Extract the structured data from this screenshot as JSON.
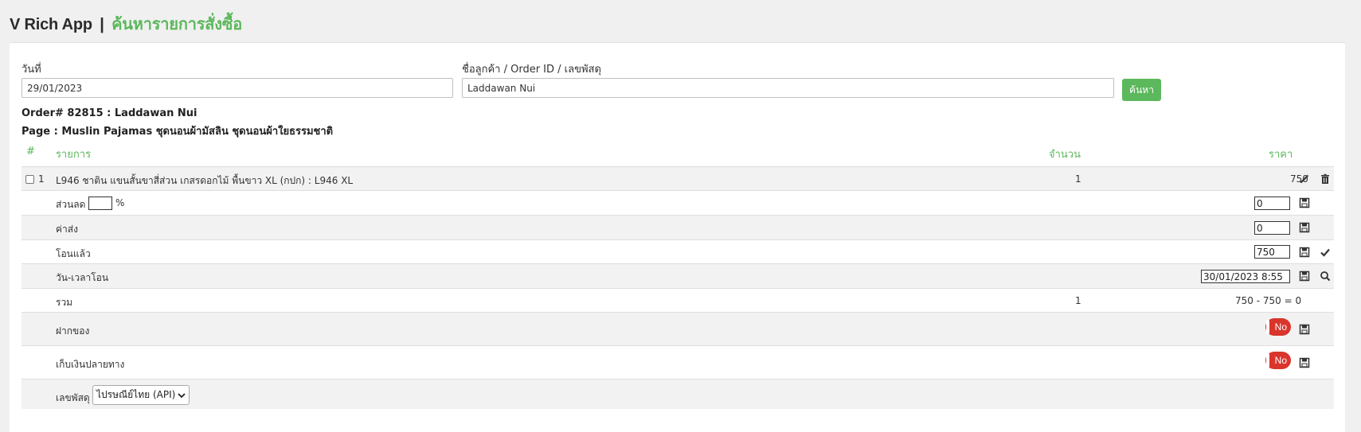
{
  "header": {
    "app": "V Rich App",
    "sep": "|",
    "page": "ค้นหารายการสั่งซื้อ"
  },
  "search": {
    "date_label": "วันที่",
    "date_value": "29/01/2023",
    "query_label": "ชื่อลูกค้า / Order ID / เลขพัสดุ",
    "query_value": "Laddawan Nui",
    "button": "ค้นหา"
  },
  "order": {
    "title": "Order# 82815 : Laddawan Nui",
    "page": "Page : Muslin Pajamas ชุดนอนผ้ามัสลิน ชุดนอนผ้าใยธรรมชาติ"
  },
  "table": {
    "headers": {
      "num": "#",
      "item": "รายการ",
      "qty": "จำนวน",
      "price": "ราคา"
    },
    "item": {
      "index": "1",
      "name": "L946 ชาติน แขนสั้นขาสี่ส่วน เกสรดอกไม้ พื้นขาว XL (กปก) : L946 XL",
      "qty": "1",
      "price": "750"
    },
    "discount": {
      "label": "ส่วนลด",
      "percent": "",
      "unit": "%",
      "value": "0"
    },
    "shipping": {
      "label": "ค่าส่ง",
      "value": "0"
    },
    "paid": {
      "label": "โอนแล้ว",
      "value": "750"
    },
    "paid_time": {
      "label": "วัน-เวลาโอน",
      "value": "30/01/2023 8:55"
    },
    "total": {
      "label": "รวม",
      "qty": "1",
      "formula": "750 - 750 = 0"
    },
    "deposit": {
      "label": "ฝากของ",
      "toggle": "No"
    },
    "cod": {
      "label": "เก็บเงินปลายทาง",
      "toggle": "No"
    },
    "tracking": {
      "label": "เลขพัสดุ",
      "selected": "ไปรษณีย์ไทย (API)"
    }
  },
  "colors": {
    "accent": "#5cb85c",
    "danger": "#d9352c"
  }
}
